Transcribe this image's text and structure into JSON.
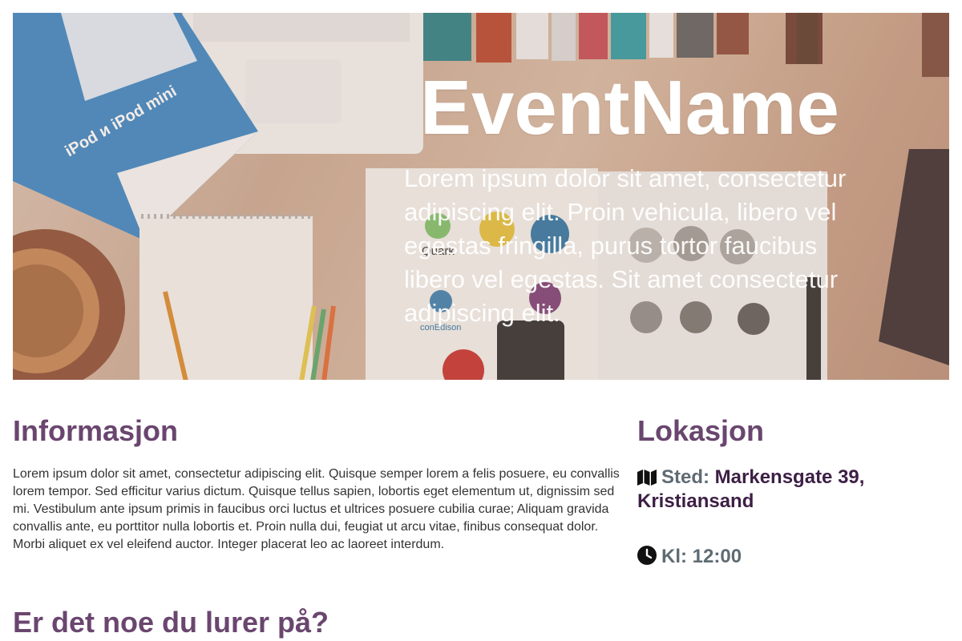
{
  "hero": {
    "title": "EventName",
    "text": "Lorem ipsum dolor sit amet, consectetur adipiscing elit. Proin vehicula, libero vel egestas fringilla, purus tortor faucibus libero vel egestas. Sit amet consectetur adipiscing elit.",
    "image_text": {
      "ipod": "iPod и iPod mini",
      "quark": "Quark",
      "conedison": "conEdison"
    }
  },
  "info": {
    "heading": "Informasjon",
    "body": "Lorem ipsum dolor sit amet, consectetur adipiscing elit. Quisque semper lorem a felis posuere, eu convallis lorem tempor. Sed efficitur varius dictum. Quisque tellus sapien, lobortis eget elementum ut, dignissim sed mi. Vestibulum ante ipsum primis in faucibus orci luctus et ultrices posuere cubilia curae; Aliquam gravida convallis ante, eu porttitor nulla lobortis et. Proin nulla dui, feugiat ut arcu vitae, finibus consequat dolor. Morbi aliquet ex vel eleifend auctor. Integer placerat leo ac laoreet interdum."
  },
  "location": {
    "heading": "Lokasjon",
    "place_label": "Sted:",
    "place_value": "Markensgate 39, Kristiansand",
    "time_label": "Kl: 12:00"
  },
  "faq": {
    "heading": "Er det noe du lurer på?"
  },
  "icons": {
    "place": "map-icon",
    "time": "clock-icon"
  },
  "colors": {
    "heading": "#6a466f",
    "location_value": "#3d1f45",
    "location_label": "#5f6b73"
  }
}
